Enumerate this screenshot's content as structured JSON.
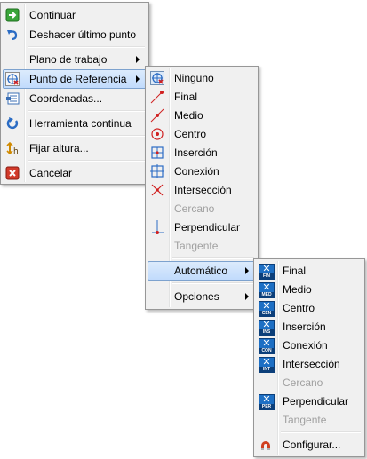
{
  "main_menu": {
    "items": [
      {
        "label": "Continuar",
        "icon": "continue-icon"
      },
      {
        "label": "Deshacer último punto",
        "icon": "undo-icon"
      },
      {
        "label": "Plano de trabajo"
      },
      {
        "label": "Punto de Referencia",
        "icon": "reference-point-icon"
      },
      {
        "label": "Coordenadas...",
        "icon": "coordinates-icon"
      },
      {
        "label": "Herramienta continua",
        "icon": "continuous-tool-icon"
      },
      {
        "label": "Fijar altura...",
        "icon": "set-height-icon"
      },
      {
        "label": "Cancelar",
        "icon": "cancel-icon"
      }
    ]
  },
  "reference_menu": {
    "items": [
      {
        "label": "Ninguno",
        "icon": "none-snap-icon"
      },
      {
        "label": "Final",
        "icon": "endpoint-snap-icon"
      },
      {
        "label": "Medio",
        "icon": "midpoint-snap-icon"
      },
      {
        "label": "Centro",
        "icon": "center-snap-icon"
      },
      {
        "label": "Inserción",
        "icon": "insertion-snap-icon"
      },
      {
        "label": "Conexión",
        "icon": "connection-snap-icon"
      },
      {
        "label": "Intersección",
        "icon": "intersection-snap-icon"
      },
      {
        "label": "Cercano"
      },
      {
        "label": "Perpendicular",
        "icon": "perpendicular-snap-icon"
      },
      {
        "label": "Tangente"
      },
      {
        "label": "Automático"
      },
      {
        "label": "Opciones"
      }
    ]
  },
  "auto_menu": {
    "items": [
      {
        "label": "Final",
        "tag": "FIN"
      },
      {
        "label": "Medio",
        "tag": "MED"
      },
      {
        "label": "Centro",
        "tag": "CEN"
      },
      {
        "label": "Inserción",
        "tag": "INS"
      },
      {
        "label": "Conexión",
        "tag": "CON"
      },
      {
        "label": "Intersección",
        "tag": "INT"
      },
      {
        "label": "Cercano"
      },
      {
        "label": "Perpendicular",
        "tag": "PER"
      },
      {
        "label": "Tangente"
      },
      {
        "label": "Configurar...",
        "icon": "configure-magnet-icon"
      }
    ]
  },
  "colors": {
    "menu_bg": "#f0f0f0",
    "highlight": "#c1dbfc",
    "disabled_text": "#a0a0a0",
    "snap_icon_blue": "#1d6fc4"
  }
}
